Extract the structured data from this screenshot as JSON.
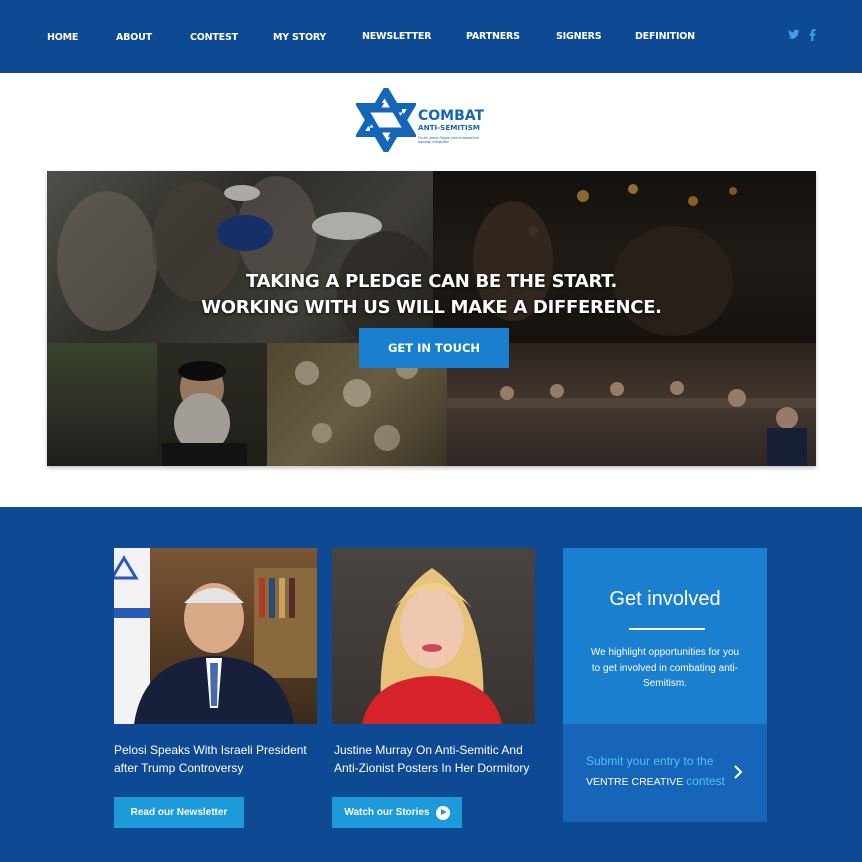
{
  "nav": {
    "items": [
      "HOME",
      "ABOUT",
      "CONTEST",
      "MY STORY",
      "NEWSLETTER",
      "PARTNERS",
      "SIGNERS",
      "DEFINITION"
    ],
    "social": {
      "twitter_icon": "twitter-icon",
      "facebook_icon": "facebook-icon"
    }
  },
  "logo": {
    "title": "COMBAT",
    "subtitle": "ANTI-SEMITISM",
    "tagline": "For the Jewish People, their homeland and humanity, everywhere"
  },
  "hero": {
    "line1": "TAKING A PLEDGE CAN BE THE START.",
    "line2": "WORKING WITH US WILL MAKE A DIFFERENCE.",
    "button": "GET IN TOUCH"
  },
  "stories": [
    {
      "caption": "Pelosi Speaks With Israeli President after Trump Controversy",
      "button": "Read our Newsletter"
    },
    {
      "caption": "Justine Murray On Anti-Semitic And Anti-Zionist Posters In Her Dormitory",
      "button": "Watch our Stories"
    }
  ],
  "involve": {
    "title": "Get involved",
    "text": "We highlight opportunities for you to get involved in combating anti-Semitism.",
    "submit_line1": "Submit your entry to the",
    "submit_line2_prefix": "VENTRE CREATIVE",
    "submit_line2_accent": "contest"
  },
  "colors": {
    "nav_bg": "#0e4a94",
    "section_bg": "#0e4a94",
    "accent_blue": "#1a7fcf",
    "button_blue": "#1d9ad9",
    "link_cyan": "#4ec3f0"
  }
}
